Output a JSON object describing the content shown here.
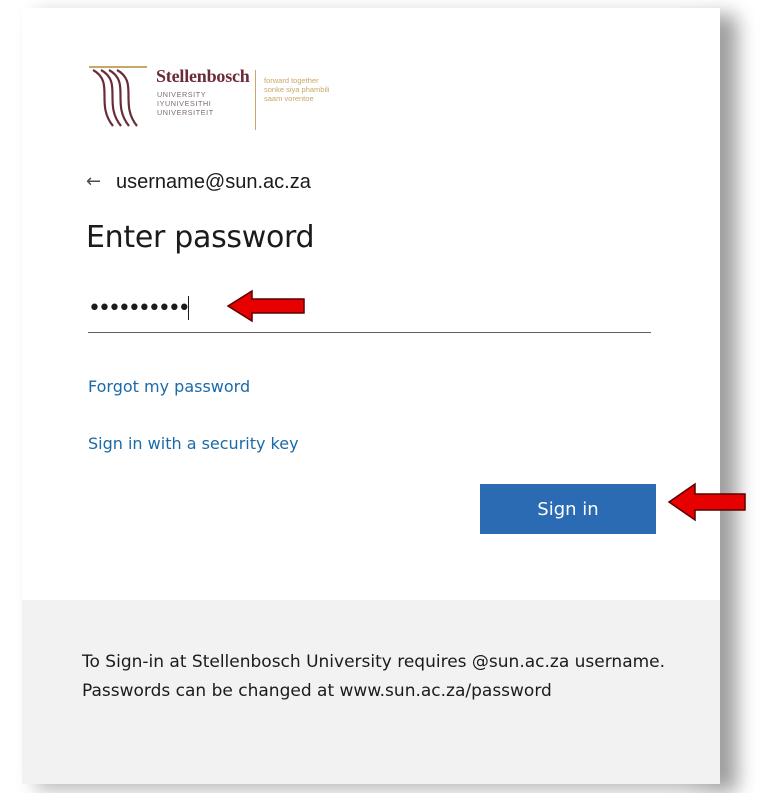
{
  "logo": {
    "name": "Stellenbosch",
    "sub_lines": [
      "UNIVERSITY",
      "IYUNIVESITHI",
      "UNIVERSITEIT"
    ],
    "tagline_lines": [
      "forward together",
      "sonke siya phambili",
      "saam vorentoe"
    ]
  },
  "identity": {
    "back_icon": "arrow-left-icon",
    "email": "username@sun.ac.za"
  },
  "title": "Enter password",
  "password": {
    "masked_value": "••••••••••"
  },
  "links": {
    "forgot": "Forgot my password",
    "security_key": "Sign in with a security key"
  },
  "signin_button": {
    "label": "Sign in"
  },
  "footer": {
    "text": "To Sign-in at Stellenbosch University requires @sun.ac.za username. Passwords can be changed at www.sun.ac.za/password"
  },
  "colors": {
    "brand_maroon": "#6b2c3a",
    "brand_gold": "#c9a766",
    "link_blue": "#1a6aa8",
    "button_blue": "#2b6bb3",
    "annotation_red": "#e60000",
    "footer_bg": "#f2f2f2"
  }
}
